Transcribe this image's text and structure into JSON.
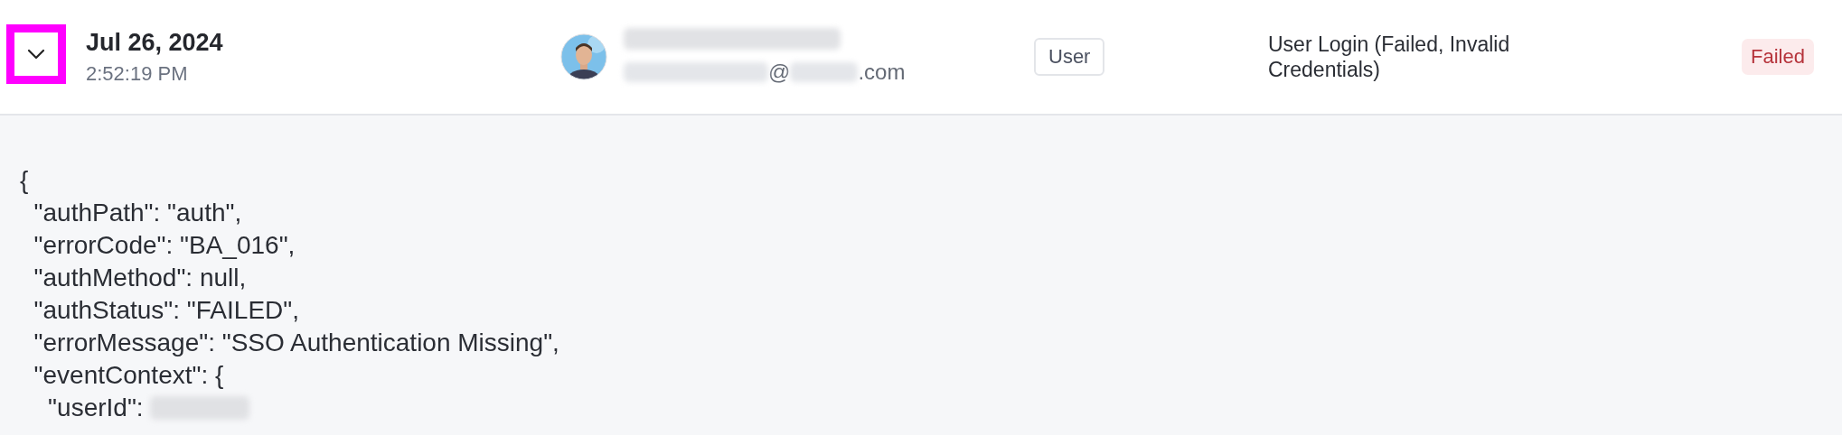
{
  "row": {
    "expanded": true,
    "highlighted": true,
    "date": "Jul 26, 2024",
    "time": "2:52:19 PM",
    "user": {
      "name_blurred": true,
      "email_parts": [
        {
          "kind": "blurred"
        },
        {
          "kind": "text",
          "text": "@"
        },
        {
          "kind": "blurred"
        },
        {
          "kind": "text",
          "text": ".com"
        }
      ]
    },
    "role": "User",
    "event": "User Login (Failed, Invalid Credentials)",
    "status": {
      "label": "Failed",
      "kind": "failed"
    }
  },
  "details": {
    "lines": [
      {
        "text": "{"
      },
      {
        "text": "  \"authPath\": \"auth\","
      },
      {
        "text": "  \"errorCode\": \"BA_016\","
      },
      {
        "text": "  \"authMethod\": null,"
      },
      {
        "text": "  \"authStatus\": \"FAILED\","
      },
      {
        "text": "  \"errorMessage\": \"SSO Authentication Missing\","
      },
      {
        "text": "  \"eventContext\": {"
      },
      {
        "text": "    \"userId\": ",
        "value_blurred": true
      }
    ]
  }
}
